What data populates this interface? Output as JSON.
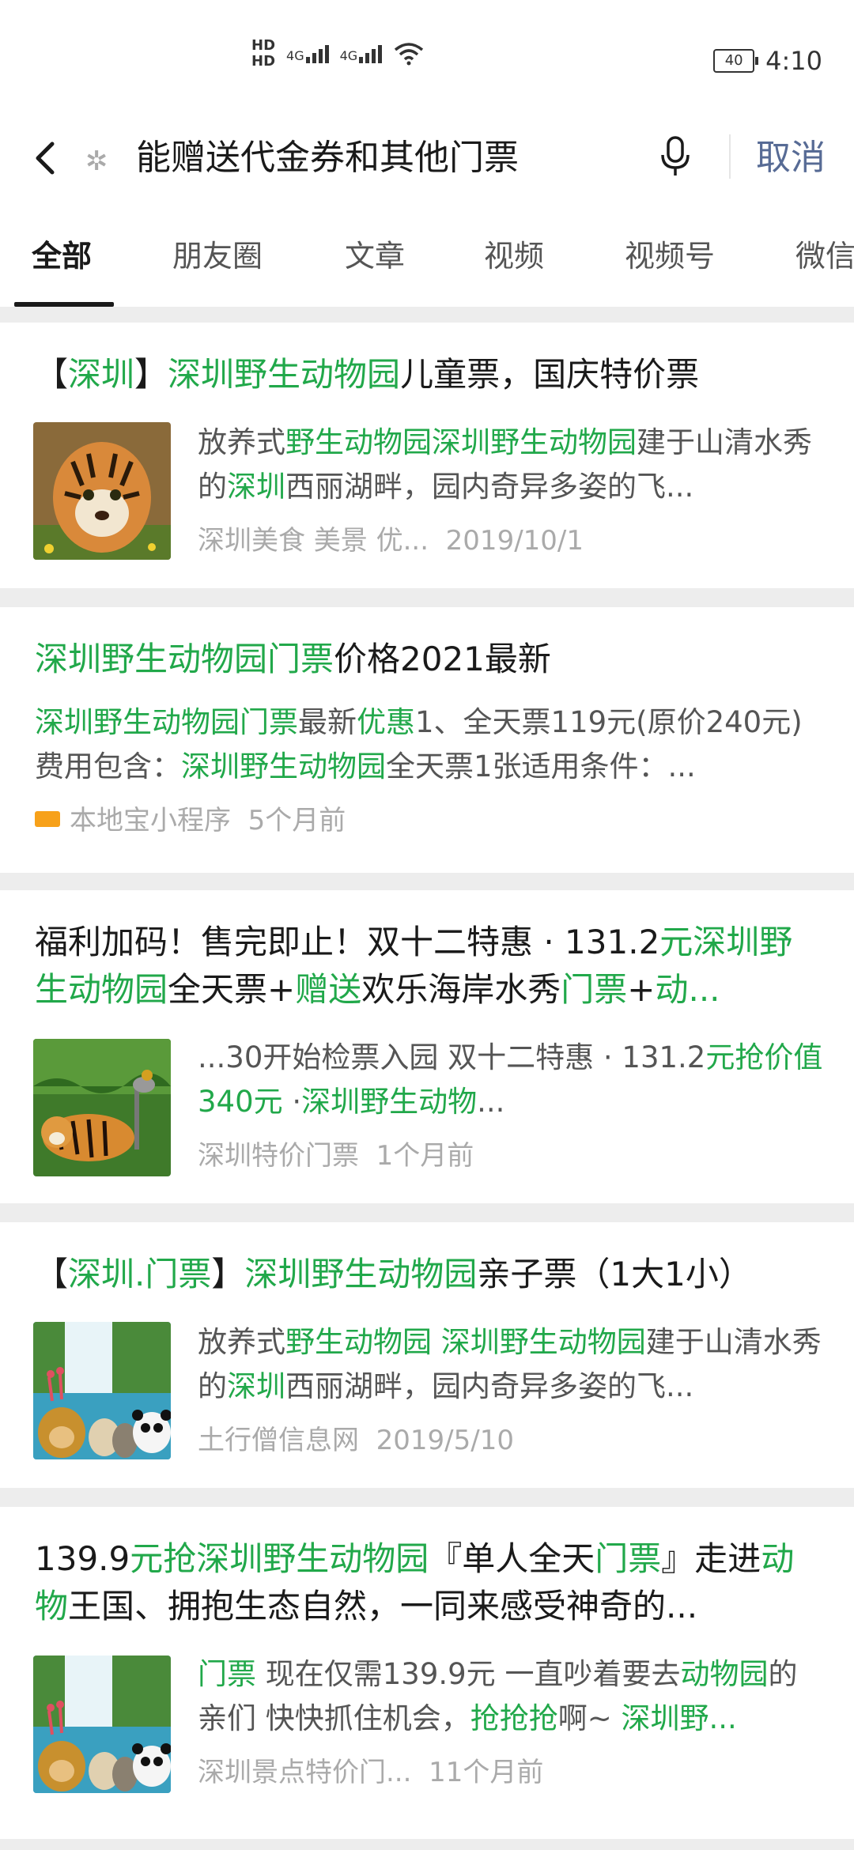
{
  "status": {
    "hd1": "HD",
    "hd2": "HD",
    "net1": "4G",
    "net2": "4G",
    "battery": "40",
    "time": "4:10"
  },
  "search": {
    "query": "能赠送代金券和其他门票",
    "cancel": "取消"
  },
  "tabs": [
    "全部",
    "朋友圈",
    "文章",
    "视频",
    "视频号",
    "微信"
  ],
  "results": [
    {
      "title": [
        {
          "t": "【"
        },
        {
          "t": "深圳",
          "g": true
        },
        {
          "t": "】"
        },
        {
          "t": "深圳野生动物园",
          "g": true
        },
        {
          "t": "儿童票，国庆特价票"
        }
      ],
      "desc": [
        {
          "t": "放养式"
        },
        {
          "t": "野生动物园深圳野生动物园",
          "g": true
        },
        {
          "t": "建于山清水秀的"
        },
        {
          "t": "深圳",
          "g": true
        },
        {
          "t": "西丽湖畔，园内奇异多姿的飞..."
        }
      ],
      "source": "深圳美食 美景 优...",
      "time": "2019/10/1",
      "image": "tiger-cub"
    },
    {
      "title": [
        {
          "t": "深圳野生动物园门票",
          "g": true
        },
        {
          "t": "价格2021最新"
        }
      ],
      "desc": [
        {
          "t": "深圳野生动物园门票",
          "g": true
        },
        {
          "t": "最新"
        },
        {
          "t": "优惠",
          "g": true
        },
        {
          "t": "1、全天票119元(原价240元)费用包含："
        },
        {
          "t": "深圳野生动物园",
          "g": true
        },
        {
          "t": "全天票1张适用条件：..."
        }
      ],
      "source": "本地宝小程序",
      "time": "5个月前",
      "image": "local-logo"
    },
    {
      "title": [
        {
          "t": "福利加码！售完即止！双十二特惠 · 131.2"
        },
        {
          "t": "元深圳野生动物园",
          "g": true
        },
        {
          "t": "全天票+"
        },
        {
          "t": "赠送",
          "g": true
        },
        {
          "t": "欢乐海岸水秀"
        },
        {
          "t": "门票",
          "g": true
        },
        {
          "t": "+"
        },
        {
          "t": "动...",
          "g": true
        }
      ],
      "desc": [
        {
          "t": "...30开始检票入园 双十二特惠 · 131.2"
        },
        {
          "t": "元抢价值340元",
          "g": true
        },
        {
          "t": " ·"
        },
        {
          "t": "深圳野生动物",
          "g": true
        },
        {
          "t": "..."
        }
      ],
      "source": "深圳特价门票",
      "time": "1个月前",
      "image": "tiger-crane"
    },
    {
      "title": [
        {
          "t": "【"
        },
        {
          "t": "深圳.门票",
          "g": true
        },
        {
          "t": "】"
        },
        {
          "t": "深圳野生动物园",
          "g": true
        },
        {
          "t": "亲子票（1大1小）"
        }
      ],
      "desc": [
        {
          "t": "放养式"
        },
        {
          "t": "野生动物园 深圳野生动物园",
          "g": true
        },
        {
          "t": "建于山清水秀的"
        },
        {
          "t": "深圳",
          "g": true
        },
        {
          "t": "西丽湖畔，园内奇异多姿的飞..."
        }
      ],
      "source": "土行僧信息网",
      "time": "2019/5/10",
      "image": "animals-waterfall"
    },
    {
      "title": [
        {
          "t": "139.9"
        },
        {
          "t": "元抢深圳野生动物园",
          "g": true
        },
        {
          "t": "『单人全天"
        },
        {
          "t": "门票",
          "g": true
        },
        {
          "t": "』走进"
        },
        {
          "t": "动物",
          "g": true
        },
        {
          "t": "王国、拥抱生态自然，一同来感受神奇的..."
        }
      ],
      "desc": [
        {
          "t": "门票",
          "g": true
        },
        {
          "t": " 现在仅需139.9元 一直吵着要去"
        },
        {
          "t": "动物园",
          "g": true
        },
        {
          "t": "的亲们 快快抓住机会，"
        },
        {
          "t": "抢抢抢",
          "g": true
        },
        {
          "t": "啊~ "
        },
        {
          "t": "深圳野...",
          "g": true
        }
      ],
      "source": "深圳景点特价门...",
      "time": "11个月前",
      "image": "animals-waterfall"
    }
  ]
}
